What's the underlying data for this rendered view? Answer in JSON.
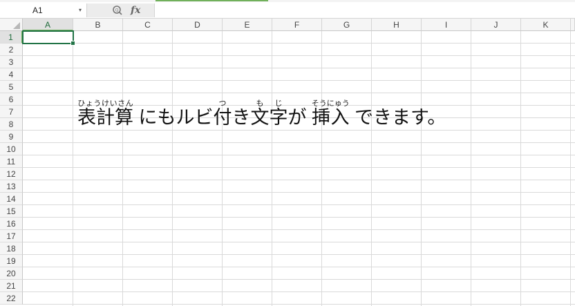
{
  "name_box": {
    "value": "A1",
    "dropdown_glyph": "▾"
  },
  "formula_bar": {
    "fx_label": "fx",
    "formula": ""
  },
  "columns": [
    "A",
    "B",
    "C",
    "D",
    "E",
    "F",
    "G",
    "H",
    "I",
    "J",
    "K"
  ],
  "rows": [
    "1",
    "2",
    "3",
    "4",
    "5",
    "6",
    "7",
    "8",
    "9",
    "10",
    "11",
    "12",
    "13",
    "14",
    "15",
    "16",
    "17",
    "18",
    "19",
    "20",
    "21",
    "22"
  ],
  "selected_cell": "A1",
  "cell_text": {
    "seg1_base": "表計算",
    "seg1_ruby": "ひょうけいさん",
    "seg2": " にもルビ",
    "seg3_base": "付",
    "seg3_ruby": "つ",
    "seg4": "き",
    "seg5_base": "文字",
    "seg5_ruby": "もじ",
    "seg6": "が ",
    "seg7_base": "挿入",
    "seg7_ruby": "そうにゅう",
    "seg8": " できます。"
  },
  "colors": {
    "accent": "#70b05a",
    "selection": "#217346",
    "grid": "#d9d9d9"
  }
}
